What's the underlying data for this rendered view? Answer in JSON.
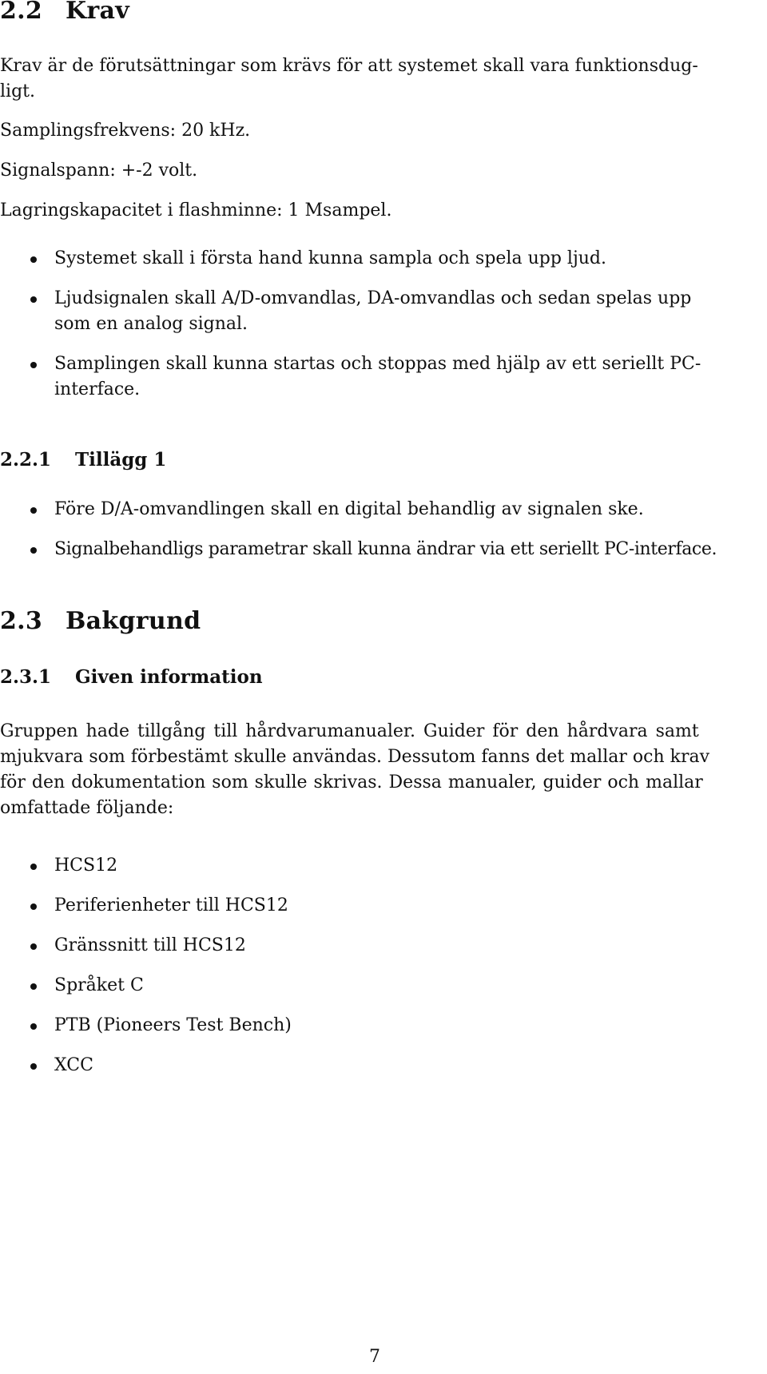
{
  "section_krav": {
    "number": "2.2",
    "title": "Krav",
    "intro_line1": "Krav är de förutsättningar som krävs för att systemet skall vara funktionsdug-",
    "intro_line2": "ligt.",
    "specs": [
      "Samplingsfrekvens: 20 kHz.",
      "Signalspann: +-2 volt.",
      "Lagringskapacitet i flashminne: 1 Msampel."
    ],
    "bullets": [
      {
        "line1": "Systemet skall i första hand kunna sampla och spela upp ljud.",
        "line2": ""
      },
      {
        "line1": "Ljudsignalen skall A/D-omvandlas, DA-omvandlas och sedan spelas upp",
        "line2": "som en analog signal."
      },
      {
        "line1": "Samplingen skall kunna startas och stoppas med hjälp av ett seriellt PC-",
        "line2": "interface."
      }
    ]
  },
  "section_tillagg": {
    "number": "2.2.1",
    "title": "Tillägg 1",
    "bullets": [
      "Före D/A-omvandlingen skall en digital behandlig av signalen ske.",
      "Signalbehandligs parametrar skall kunna ändrar via ett seriellt PC-interface."
    ]
  },
  "section_bakgrund": {
    "number": "2.3",
    "title": "Bakgrund"
  },
  "section_given": {
    "number": "2.3.1",
    "title": "Given information",
    "paragraph_lines": [
      "Gruppen hade tillgång till hårdvarumanualer. Guider för den hårdvara samt",
      "mjukvara som förbestämt skulle användas. Dessutom fanns det mallar och krav",
      "för den dokumentation som skulle skrivas. Dessa manualer, guider och mallar",
      "omfattade följande:"
    ],
    "list": [
      "HCS12",
      "Periferienheter till HCS12",
      "Gränssnitt till HCS12",
      "Språket C",
      "PTB (Pioneers Test Bench)",
      "XCC"
    ]
  },
  "page_number": "7"
}
